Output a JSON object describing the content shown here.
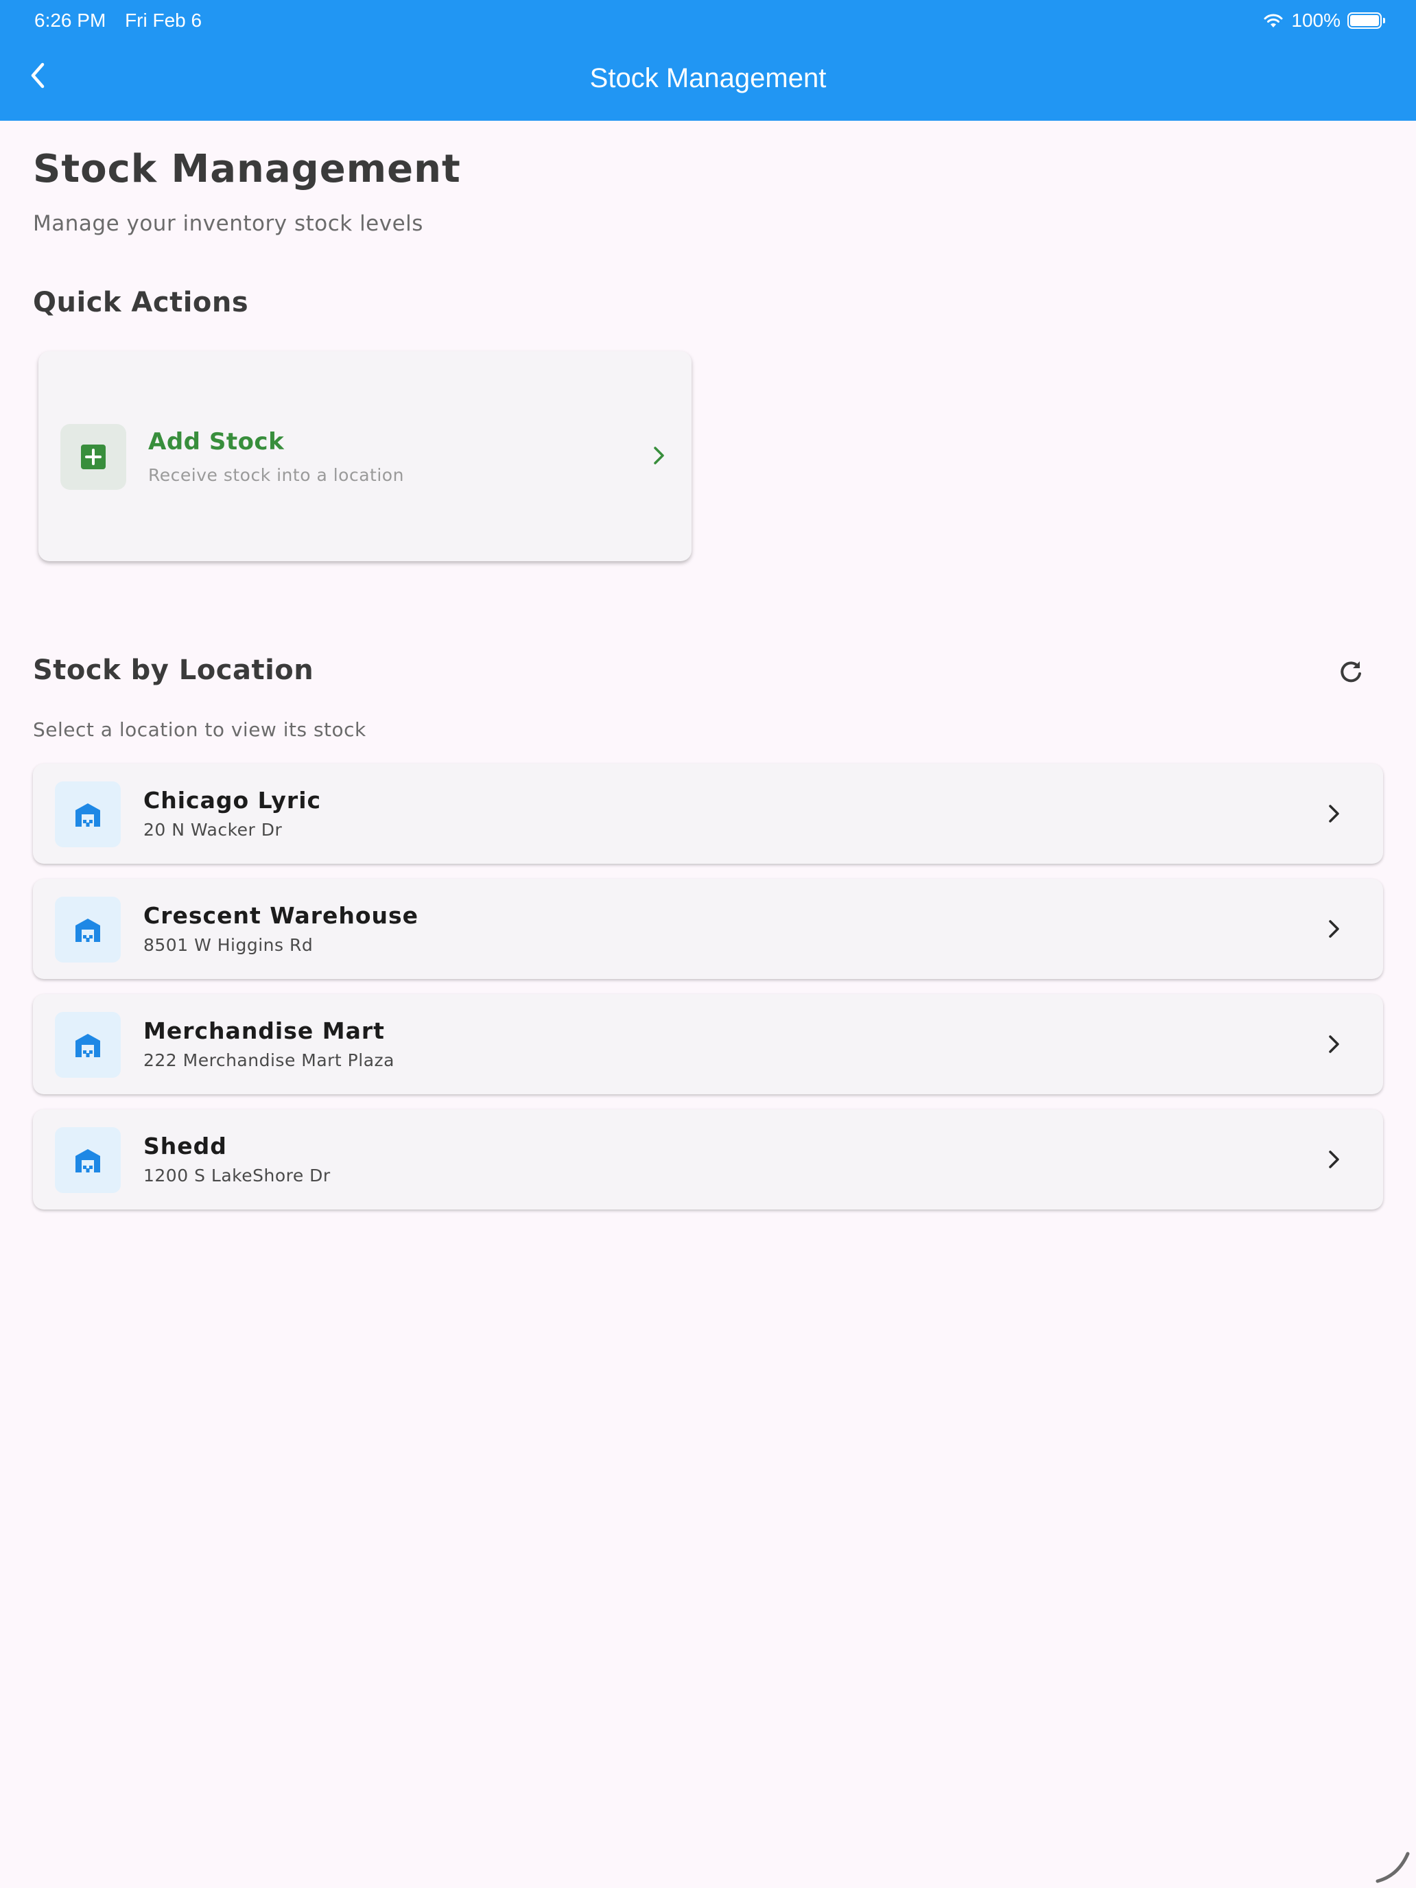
{
  "status_bar": {
    "time": "6:26 PM",
    "date": "Fri Feb 6",
    "battery": "100%"
  },
  "appbar": {
    "title": "Stock Management",
    "back_icon": "chevron-left-icon"
  },
  "page": {
    "title": "Stock Management",
    "subtitle": "Manage your inventory stock levels"
  },
  "quick_actions": {
    "heading": "Quick Actions",
    "add_stock": {
      "title": "Add Stock",
      "subtitle": "Receive stock into a location",
      "icon": "add-box-icon"
    }
  },
  "stock_by_location": {
    "heading": "Stock by Location",
    "help": "Select a location to view its stock",
    "refresh_icon": "refresh-icon",
    "locations": [
      {
        "name": "Chicago Lyric",
        "address": "20 N Wacker Dr"
      },
      {
        "name": "Crescent Warehouse",
        "address": "8501 W Higgins Rd"
      },
      {
        "name": "Merchandise Mart",
        "address": "222 Merchandise Mart Plaza"
      },
      {
        "name": "Shedd",
        "address": "1200 S LakeShore Dr"
      }
    ]
  },
  "colors": {
    "appbar": "#2196f3",
    "background": "#fdf7fc",
    "add_accent": "#388e3c",
    "location_accent": "#1e88e5"
  }
}
